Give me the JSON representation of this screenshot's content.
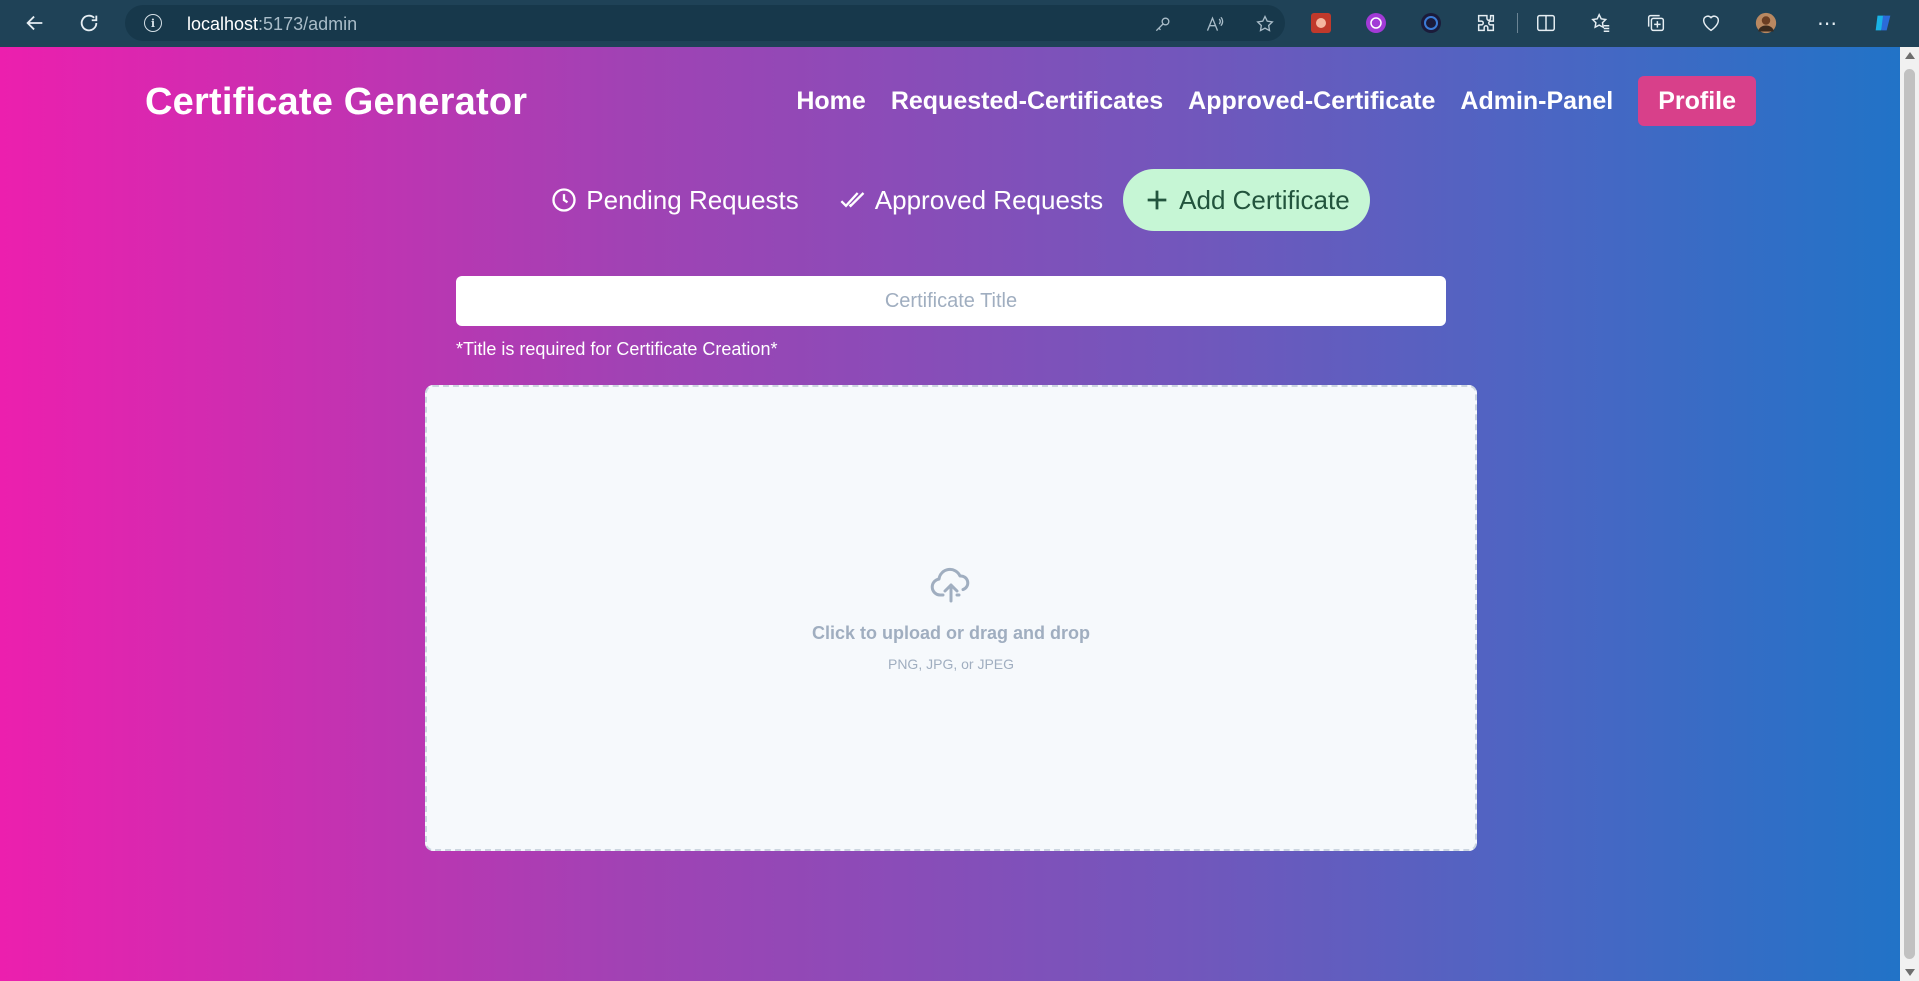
{
  "browser": {
    "url_host": "localhost",
    "url_path": ":5173/admin"
  },
  "app": {
    "brand": "Certificate Generator",
    "nav": [
      {
        "label": "Home"
      },
      {
        "label": "Requested-Certificates"
      },
      {
        "label": "Approved-Certificate"
      },
      {
        "label": "Admin-Panel"
      }
    ],
    "profile_label": "Profile"
  },
  "tabs": [
    {
      "label": "Pending Requests",
      "icon": "clock-icon"
    },
    {
      "label": "Approved Requests",
      "icon": "double-check-icon"
    },
    {
      "label": "Add Certificate",
      "icon": "plus-icon",
      "active": true
    }
  ],
  "form": {
    "title_placeholder": "Certificate Title",
    "title_value": "",
    "hint": "*Title is required for Certificate Creation*",
    "upload_primary": "Click to upload or drag and drop",
    "upload_secondary": "PNG, JPG, or JPEG"
  },
  "colors": {
    "gradient_start": "#ec1fae",
    "gradient_end": "#2173c7",
    "profile_button": "#d8408a",
    "active_tab_bg": "#c6f6d5",
    "active_tab_text": "#22543d"
  }
}
